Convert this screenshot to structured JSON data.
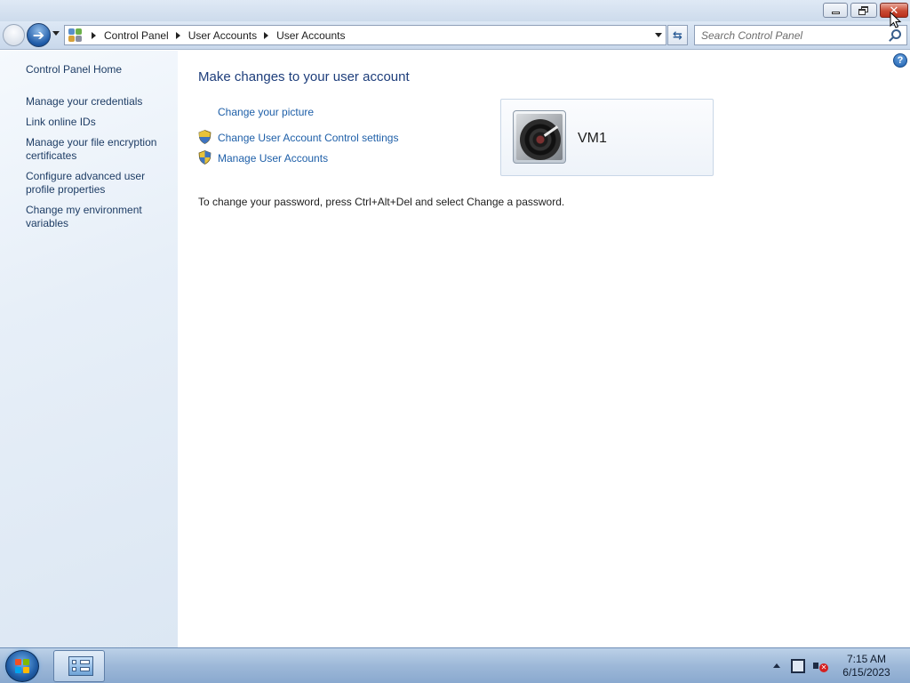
{
  "window": {
    "minimize_label": "Minimize",
    "maximize_label": "Restore Down",
    "close_label": "Close"
  },
  "navigation": {
    "breadcrumbs": [
      "Control Panel",
      "User Accounts",
      "User Accounts"
    ],
    "search_placeholder": "Search Control Panel"
  },
  "sidebar": {
    "home": "Control Panel Home",
    "items": [
      {
        "label": "Manage your credentials"
      },
      {
        "label": "Link online IDs"
      },
      {
        "label": "Manage your file encryption certificates"
      },
      {
        "label": "Configure advanced user profile properties"
      },
      {
        "label": "Change my environment variables"
      }
    ]
  },
  "main": {
    "title": "Make changes to your user account",
    "tasks": [
      {
        "label": "Change your picture",
        "icon": "none"
      },
      {
        "label": "Change User Account Control settings",
        "icon": "shield-icon"
      },
      {
        "label": "Manage User Accounts",
        "icon": "shield-icon"
      }
    ],
    "password_note": "To change your password, press Ctrl+Alt+Del and select Change a password.",
    "account": {
      "name": "VM1",
      "picture": "turntable-record"
    }
  },
  "taskbar": {
    "time": "7:15 AM",
    "date": "6/15/2023",
    "running_app": "Control Panel"
  },
  "colors": {
    "link": "#1e5fa8",
    "title": "#1e3e7b",
    "sidebar_link": "#1e3d65",
    "close_button": "#c94a33"
  }
}
